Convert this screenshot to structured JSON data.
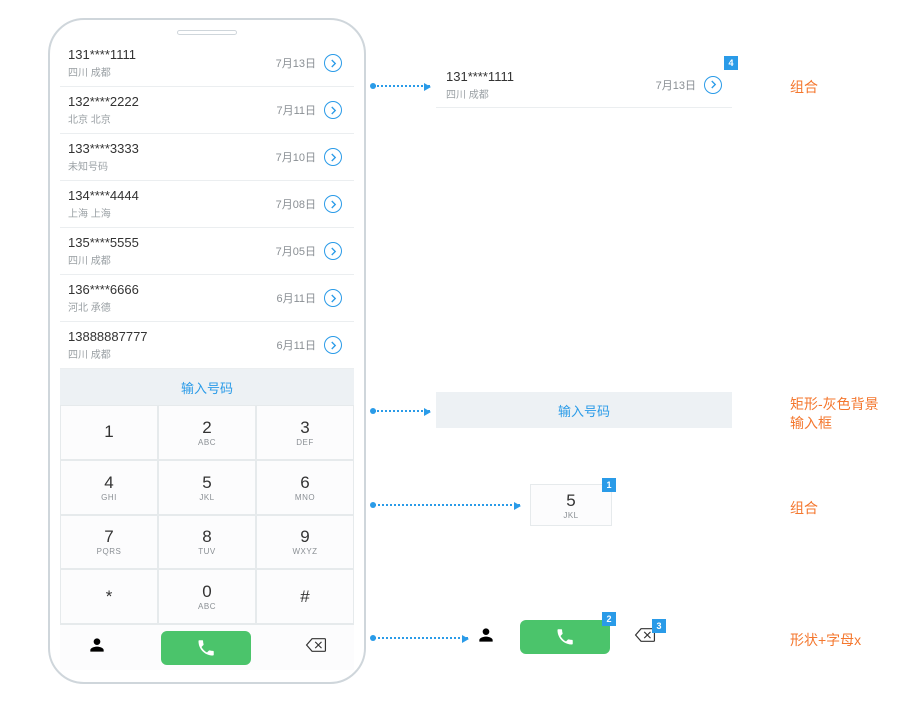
{
  "phone": {
    "calls": [
      {
        "number": "131****1111",
        "location": "四川 成都",
        "date": "7月13日"
      },
      {
        "number": "132****2222",
        "location": "北京 北京",
        "date": "7月11日"
      },
      {
        "number": "133****3333",
        "location": "未知号码",
        "date": "7月10日"
      },
      {
        "number": "134****4444",
        "location": "上海 上海",
        "date": "7月08日"
      },
      {
        "number": "135****5555",
        "location": "四川 成都",
        "date": "7月05日"
      },
      {
        "number": "136****6666",
        "location": "河北 承德",
        "date": "6月11日"
      },
      {
        "number": "13888887777",
        "location": "四川 成都",
        "date": "6月11日"
      }
    ],
    "input_placeholder": "输入号码",
    "keys": [
      {
        "digit": "1",
        "letters": ""
      },
      {
        "digit": "2",
        "letters": "ABC"
      },
      {
        "digit": "3",
        "letters": "DEF"
      },
      {
        "digit": "4",
        "letters": "GHI"
      },
      {
        "digit": "5",
        "letters": "JKL"
      },
      {
        "digit": "6",
        "letters": "MNO"
      },
      {
        "digit": "7",
        "letters": "PQRS"
      },
      {
        "digit": "8",
        "letters": "TUV"
      },
      {
        "digit": "9",
        "letters": "WXYZ"
      },
      {
        "digit": "*",
        "letters": ""
      },
      {
        "digit": "0",
        "letters": "ABC"
      },
      {
        "digit": "#",
        "letters": ""
      }
    ]
  },
  "annotations": {
    "row_example": {
      "number": "131****1111",
      "location": "四川 成都",
      "date": "7月13日",
      "badge": "4",
      "label": "组合"
    },
    "input_example": {
      "text": "输入号码",
      "label_line1": "矩形-灰色背景",
      "label_line2": "输入框"
    },
    "key_example": {
      "digit": "5",
      "letters": "JKL",
      "badge": "1",
      "label": "组合"
    },
    "bottom_example": {
      "badge_call": "2",
      "badge_backspace": "3",
      "label": "形状+字母x"
    }
  }
}
